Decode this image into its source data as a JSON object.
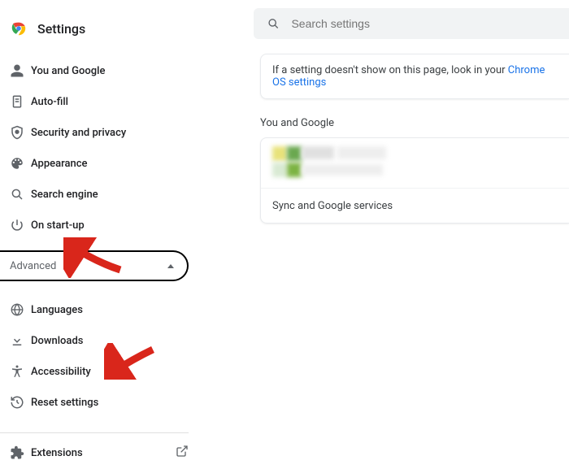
{
  "header": {
    "title": "Settings"
  },
  "search": {
    "placeholder": "Search settings"
  },
  "sidebar": {
    "items_main": [
      {
        "label": "You and Google"
      },
      {
        "label": "Auto-fill"
      },
      {
        "label": "Security and privacy"
      },
      {
        "label": "Appearance"
      },
      {
        "label": "Search engine"
      },
      {
        "label": "On start-up"
      }
    ],
    "advanced_label": "Advanced",
    "items_advanced": [
      {
        "label": "Languages"
      },
      {
        "label": "Downloads"
      },
      {
        "label": "Accessibility"
      },
      {
        "label": "Reset settings"
      }
    ],
    "extensions_label": "Extensions"
  },
  "notice": {
    "prefix": "If a setting doesn't show on this page, look in your ",
    "link_text": "Chrome OS settings"
  },
  "main": {
    "section_title": "You and Google",
    "sync_label": "Sync and Google services"
  },
  "colors": {
    "link": "#1a73e8",
    "icon": "#5f6368",
    "arrow": "#d9261b"
  }
}
